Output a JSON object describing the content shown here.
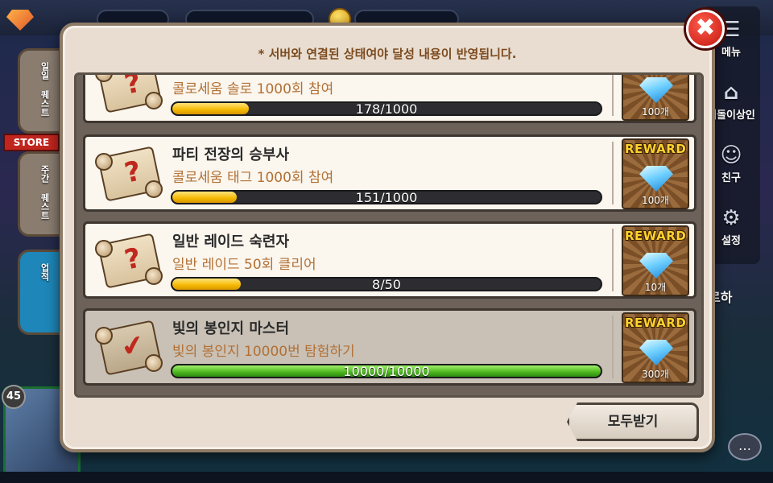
{
  "background": {
    "store_label": "STORE",
    "level": "45",
    "right_text": "르하",
    "side_tabs": [
      "일일 퀘스트",
      "주간 퀘스트",
      "업적"
    ],
    "menu": [
      {
        "label": "메뉴",
        "icon": "menu-icon"
      },
      {
        "label": "떠돌이상인",
        "icon": "merchant-icon"
      },
      {
        "label": "친구",
        "icon": "friends-icon"
      },
      {
        "label": "설정",
        "icon": "settings-icon"
      }
    ]
  },
  "popup": {
    "notice": "* 서버와 연결된 상태여야 달성 내용이 반영됩니다.",
    "claim_all_label": "모두받기",
    "reward_tag": "REWARD",
    "quests": [
      {
        "title": "",
        "desc": "콜로세움 솔로 1000회 참여",
        "progress_text": "178/1000",
        "progress": 0.178,
        "reward_qty": "100개",
        "completed": false
      },
      {
        "title": "파티 전장의 승부사",
        "desc": "콜로세움 태그 1000회 참여",
        "progress_text": "151/1000",
        "progress": 0.151,
        "reward_qty": "100개",
        "completed": false
      },
      {
        "title": "일반 레이드 숙련자",
        "desc": "일반 레이드 50회 클리어",
        "progress_text": "8/50",
        "progress": 0.16,
        "reward_qty": "10개",
        "completed": false
      },
      {
        "title": "빛의 봉인지 마스터",
        "desc": "빛의 봉인지 10000번 탐험하기",
        "progress_text": "10000/10000",
        "progress": 1.0,
        "reward_qty": "300개",
        "completed": true
      }
    ]
  },
  "colors": {
    "accent_text": "#b27034",
    "progress_yellow": "#f4b800",
    "progress_green": "#4cb51c",
    "close_red": "#c2180e",
    "reward_gold": "#ffd22e"
  }
}
